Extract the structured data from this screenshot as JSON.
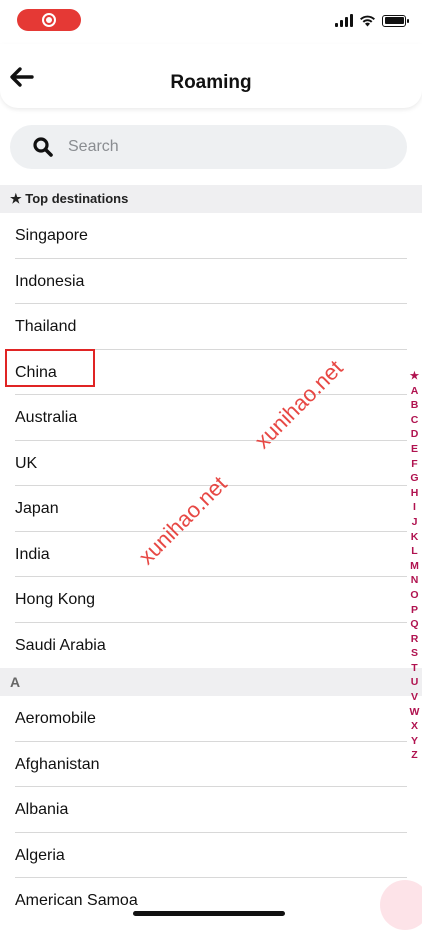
{
  "header": {
    "title": "Roaming"
  },
  "search": {
    "placeholder": "Search"
  },
  "sections": [
    {
      "title": "★ Top destinations",
      "items": [
        "Singapore",
        "Indonesia",
        "Thailand",
        "China",
        "Australia",
        "UK",
        "Japan",
        "India",
        "Hong Kong",
        "Saudi Arabia"
      ]
    },
    {
      "title": "A",
      "items": [
        "Aeromobile",
        "Afghanistan",
        "Albania",
        "Algeria",
        "American Samoa"
      ]
    }
  ],
  "index": [
    "★",
    "A",
    "B",
    "C",
    "D",
    "E",
    "F",
    "G",
    "H",
    "I",
    "J",
    "K",
    "L",
    "M",
    "N",
    "O",
    "P",
    "Q",
    "R",
    "S",
    "T",
    "U",
    "V",
    "W",
    "X",
    "Y",
    "Z"
  ],
  "watermark": "xunihao.net",
  "colors": {
    "accent": "#b0124f",
    "record": "#e53935",
    "highlight": "#e02424"
  }
}
